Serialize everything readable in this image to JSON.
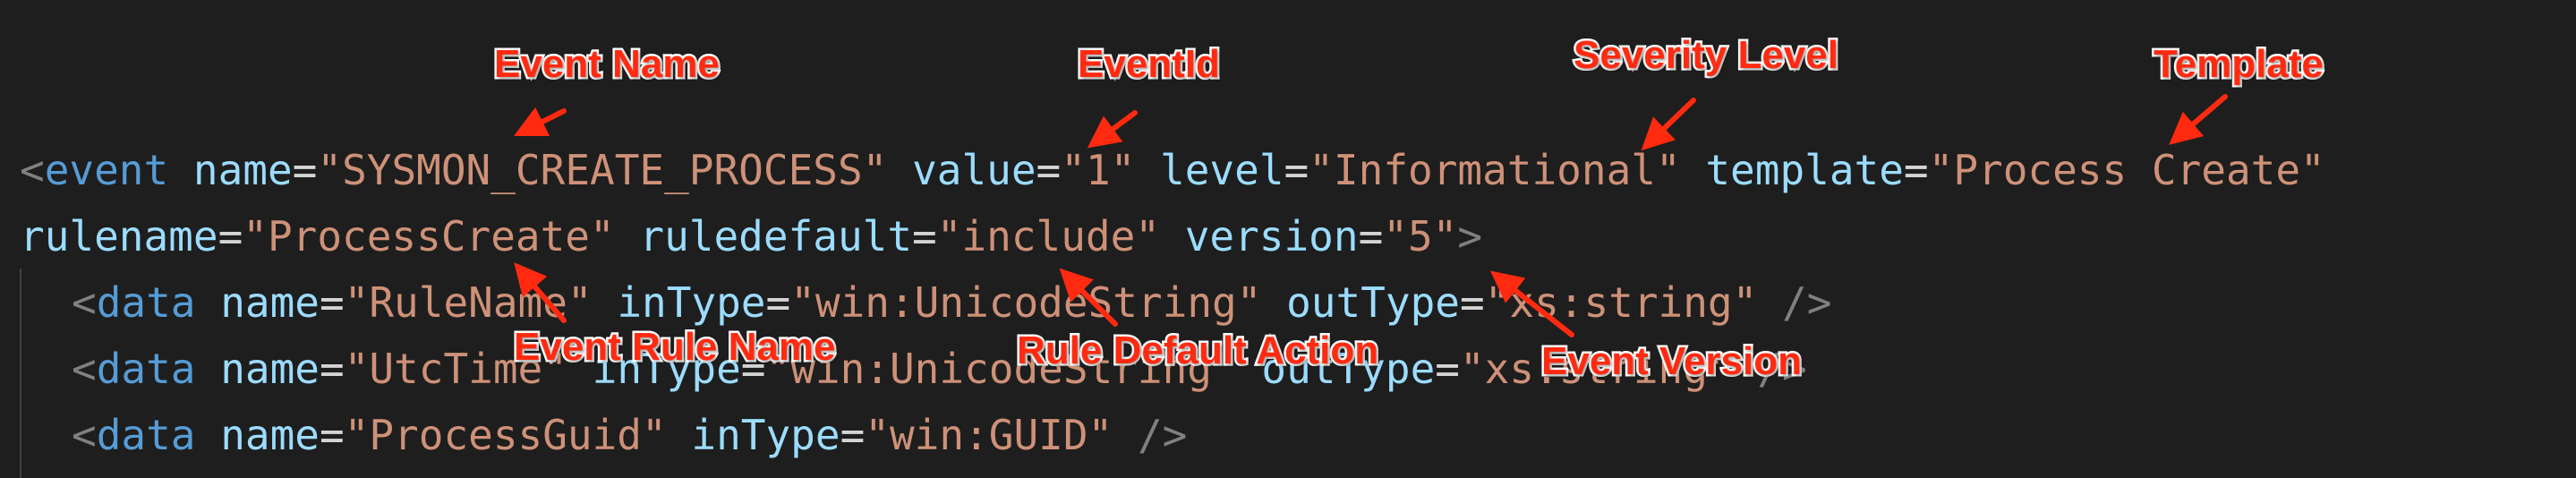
{
  "code_lines": {
    "line1": {
      "open": "<",
      "tag": "event",
      "a1_name": "name",
      "a1_eq": "=",
      "a1_val": "\"SYSMON_CREATE_PROCESS\"",
      "a2_name": "value",
      "a2_eq": "=",
      "a2_val": "\"1\"",
      "a3_name": "level",
      "a3_eq": "=",
      "a3_val": "\"Informational\"",
      "a4_name": "template",
      "a4_eq": "=",
      "a4_val": "\"Process Create\""
    },
    "line2": {
      "a1_name": "rulename",
      "a1_eq": "=",
      "a1_val": "\"ProcessCreate\"",
      "a2_name": "ruledefault",
      "a2_eq": "=",
      "a2_val": "\"include\"",
      "a3_name": "version",
      "a3_eq": "=",
      "a3_val": "\"5\"",
      "close": ">"
    },
    "line3": {
      "open": "<",
      "tag": "data",
      "a1_name": "name",
      "a1_eq": "=",
      "a1_val": "\"RuleName\"",
      "a2_name": "inType",
      "a2_eq": "=",
      "a2_val": "\"win:UnicodeString\"",
      "a3_name": "outType",
      "a3_eq": "=",
      "a3_val": "\"xs:string\"",
      "close": "/>"
    },
    "line4": {
      "open": "<",
      "tag": "data",
      "a1_name": "name",
      "a1_eq": "=",
      "a1_val": "\"UtcTime\"",
      "a2_name": "inType",
      "a2_eq": "=",
      "a2_val": "\"win:UnicodeString\"",
      "a3_name": "outType",
      "a3_eq": "=",
      "a3_val": "\"xs:string\"",
      "close": "/>"
    },
    "line5": {
      "open": "<",
      "tag": "data",
      "a1_name": "name",
      "a1_eq": "=",
      "a1_val": "\"ProcessGuid\"",
      "a2_name": "inType",
      "a2_eq": "=",
      "a2_val": "\"win:GUID\"",
      "close": "/>"
    }
  },
  "annotations": {
    "event_name": "Event Name",
    "event_id": "EventId",
    "severity_level": "Severity Level",
    "template": "Template",
    "event_rule_name": "Event Rule Name",
    "rule_default_action": "Rule Default Action",
    "event_version": "Event Version"
  },
  "colors": {
    "background": "#1e1e1e",
    "tag": "#569cd6",
    "attribute": "#9cdcfe",
    "string": "#ce9178",
    "punctuation": "#808080",
    "annotation": "#ff2a10"
  }
}
